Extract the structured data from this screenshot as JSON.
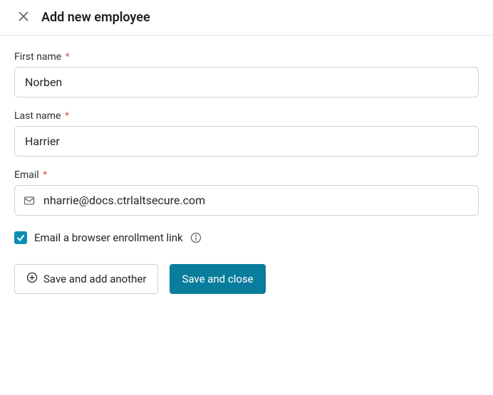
{
  "header": {
    "title": "Add new employee"
  },
  "form": {
    "firstName": {
      "label": "First name",
      "value": "Norben",
      "required": true
    },
    "lastName": {
      "label": "Last name",
      "value": "Harrier",
      "required": true
    },
    "email": {
      "label": "Email",
      "value": "nharrie@docs.ctrlaltsecure.com",
      "required": true
    },
    "enrollmentCheckbox": {
      "label": "Email a browser enrollment link",
      "checked": true
    }
  },
  "buttons": {
    "saveAndAddAnother": "Save and add another",
    "saveAndClose": "Save and close"
  },
  "requiredMarker": "*"
}
